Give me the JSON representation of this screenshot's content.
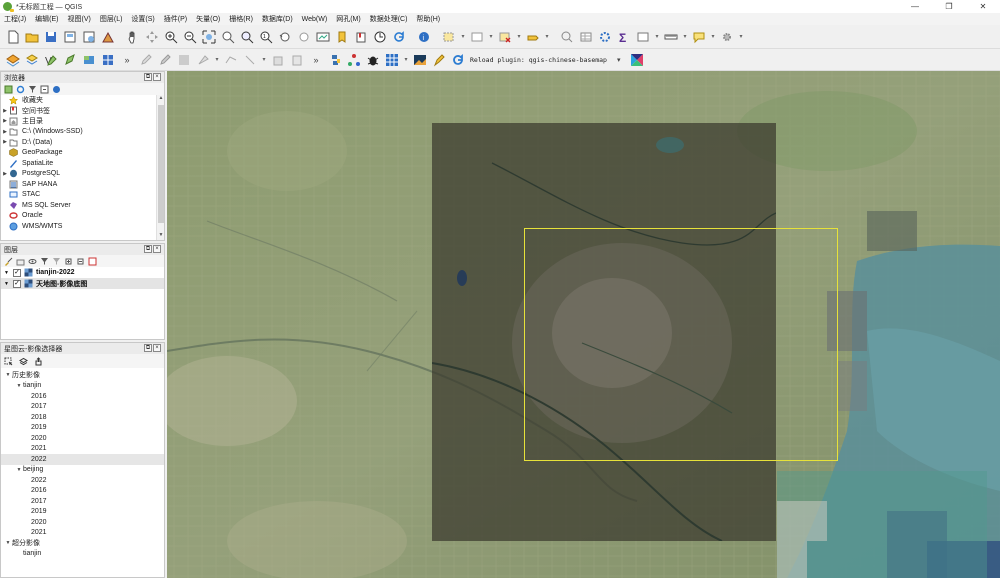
{
  "window": {
    "title": "*无标题工程 — QGIS",
    "controls": [
      "—",
      "❐",
      "✕"
    ]
  },
  "menu": [
    "工程(J)",
    "编辑(E)",
    "视图(V)",
    "图层(L)",
    "设置(S)",
    "插件(P)",
    "矢量(O)",
    "栅格(R)",
    "数据库(D)",
    "Web(W)",
    "网孔(M)",
    "数据处理(C)",
    "帮助(H)"
  ],
  "toolbar2": {
    "reload_label": "Reload plugin: qgis-chinese-basemap"
  },
  "browser": {
    "title": "浏览器",
    "items": [
      {
        "label": "收藏夹",
        "icon": "star-icon",
        "expandable": false
      },
      {
        "label": "空间书签",
        "icon": "bookmark-icon",
        "expandable": true
      },
      {
        "label": "主目录",
        "icon": "home-icon",
        "expandable": true
      },
      {
        "label": "C:\\ (Windows-SSD)",
        "icon": "drive-icon",
        "expandable": true
      },
      {
        "label": "D:\\ (Data)",
        "icon": "drive-icon",
        "expandable": true
      },
      {
        "label": "GeoPackage",
        "icon": "geopackage-icon",
        "expandable": false
      },
      {
        "label": "SpatiaLite",
        "icon": "spatialite-icon",
        "expandable": false
      },
      {
        "label": "PostgreSQL",
        "icon": "postgresql-icon",
        "expandable": true
      },
      {
        "label": "SAP HANA",
        "icon": "saphana-icon",
        "expandable": false
      },
      {
        "label": "STAC",
        "icon": "stac-icon",
        "expandable": false
      },
      {
        "label": "MS SQL Server",
        "icon": "mssql-icon",
        "expandable": false
      },
      {
        "label": "Oracle",
        "icon": "oracle-icon",
        "expandable": false
      },
      {
        "label": "WMS/WMTS",
        "icon": "wms-icon",
        "expandable": false
      }
    ]
  },
  "layers": {
    "title": "图层",
    "items": [
      {
        "label": "tianjin-2022",
        "checked": true
      },
      {
        "label": "天地图-影像底图",
        "checked": true
      }
    ]
  },
  "image_selector": {
    "title": "星图云-影像选择器",
    "tree": {
      "history_label": "历史影像",
      "tianjin_label": "tianjin",
      "tianjin_years": [
        "2016",
        "2017",
        "2018",
        "2019",
        "2020",
        "2021",
        "2022"
      ],
      "tianjin_selected": "2022",
      "beijing_label": "beijing",
      "beijing_years": [
        "2022",
        "2016",
        "2017",
        "2019",
        "2020",
        "2021"
      ],
      "superres_label": "超分影像",
      "superres_child": "tianjin"
    }
  },
  "colors": {
    "selection_rect": "#e7e23a",
    "sea": "#5b8f9a",
    "land": "#8c9a6c"
  }
}
